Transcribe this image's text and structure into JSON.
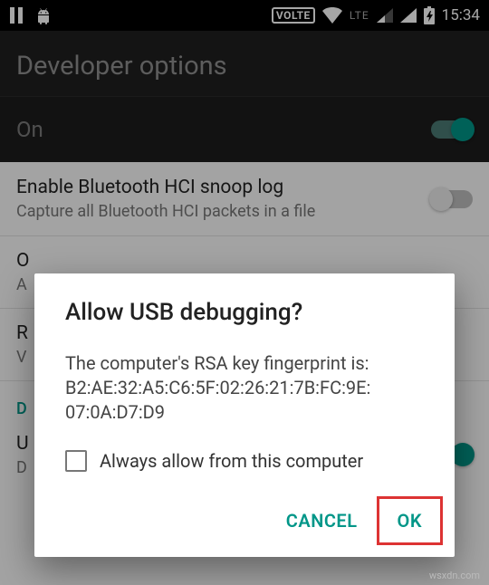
{
  "statusbar": {
    "volte": "VOLTE",
    "lte": "LTE",
    "time": "15:34"
  },
  "header": {
    "title": "Developer options"
  },
  "master": {
    "label": "On"
  },
  "settings": {
    "bluetooth_snoop": {
      "title": "Enable Bluetooth HCI snoop log",
      "sub": "Capture all Bluetooth HCI packets in a file"
    },
    "row2": {
      "title_initial": "O",
      "sub_initial": "A"
    },
    "row3": {
      "title_initial": "R",
      "sub_initial": "V"
    },
    "section_label": "D",
    "row4": {
      "title_initial": "U",
      "sub_initial": "D"
    }
  },
  "dialog": {
    "title": "Allow USB debugging?",
    "body_line1": "The computer's RSA key fingerprint is:",
    "body_line2": "B2:AE:32:A5:C6:5F:02:26:21:7B:FC:9E:",
    "body_line3": "07:0A:D7:D9",
    "checkbox_label": "Always allow from this computer",
    "cancel": "CANCEL",
    "ok": "OK"
  },
  "watermark": "wsxdn.com"
}
